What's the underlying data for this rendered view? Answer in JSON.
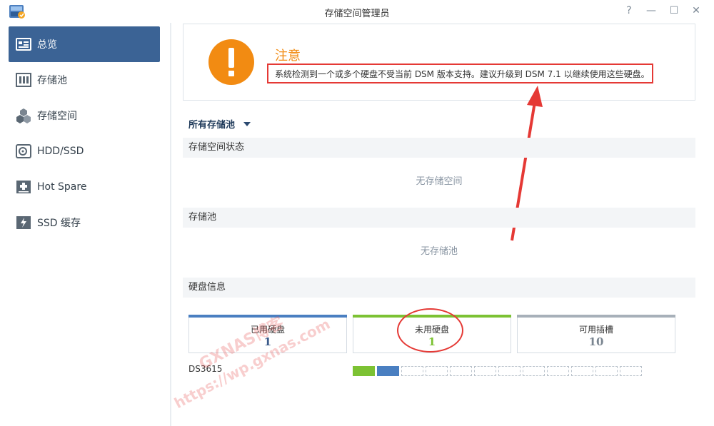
{
  "window": {
    "title": "存储空间管理员",
    "help_label": "?",
    "minimize_label": "—",
    "maximize_label": "☐",
    "close_label": "✕"
  },
  "sidebar": {
    "items": [
      {
        "label": "总览",
        "icon": "overview-icon",
        "active": true
      },
      {
        "label": "存储池",
        "icon": "storage-pool-icon",
        "active": false
      },
      {
        "label": "存储空间",
        "icon": "volume-icon",
        "active": false
      },
      {
        "label": "HDD/SSD",
        "icon": "hdd-icon",
        "active": false
      },
      {
        "label": "Hot Spare",
        "icon": "hot-spare-icon",
        "active": false
      },
      {
        "label": "SSD 缓存",
        "icon": "ssd-cache-icon",
        "active": false
      }
    ]
  },
  "notice": {
    "title": "注意",
    "message": "系统检测到一个或多个硬盘不受当前 DSM 版本支持。建议升级到 DSM 7.1 以继续使用这些硬盘。"
  },
  "pool_selector": {
    "value": "所有存储池"
  },
  "sections": {
    "volume_status": {
      "title": "存储空间状态",
      "empty": "无存储空间"
    },
    "storage_pool": {
      "title": "存储池",
      "empty": "无存储池"
    },
    "disk_info": {
      "title": "硬盘信息"
    }
  },
  "disk_cards": [
    {
      "label": "已用硬盘",
      "count": "1",
      "color": "#4a7fc1"
    },
    {
      "label": "未用硬盘",
      "count": "1",
      "color": "#7cc233"
    },
    {
      "label": "可用插槽",
      "count": "10",
      "color": "#a7b0b9"
    }
  ],
  "device": {
    "name": "DS3615",
    "slots": [
      "unused",
      "used",
      "empty",
      "empty",
      "empty",
      "empty",
      "empty",
      "empty",
      "empty",
      "empty",
      "empty",
      "empty"
    ]
  },
  "watermark": {
    "line1": "GXNAS博客",
    "line2": "https://wp.gxnas.com"
  },
  "colors": {
    "accent": "#3b6395",
    "warning": "#f28b12",
    "annotation_red": "#e53935",
    "used": "#4a7fc1",
    "unused": "#7cc233"
  }
}
